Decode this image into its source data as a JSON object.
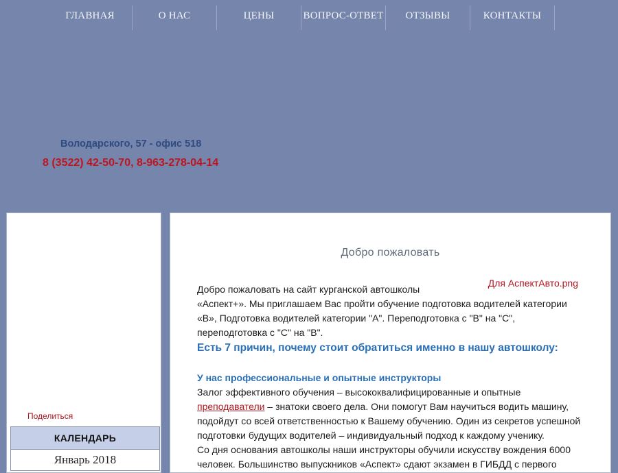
{
  "nav": {
    "items": [
      {
        "label": "ГЛАВНАЯ"
      },
      {
        "label": "О НАС"
      },
      {
        "label": "ЦЕНЫ"
      },
      {
        "label": "ВОПРОС-ОТВЕТ"
      },
      {
        "label": "ОТЗЫВЫ"
      },
      {
        "label": "КОНТАКТЫ"
      }
    ]
  },
  "header": {
    "address": "Володарского, 57 - офис 518",
    "phone": "8 (3522) 42-50-70, 8-963-278-04-14"
  },
  "sidebar": {
    "share_label": "Поделиться",
    "calendar_title": "КАЛЕНДАРЬ",
    "calendar_month": "Январь 2018"
  },
  "main": {
    "title": "Добро пожаловать",
    "image_alt": "Для АспектАвто.png",
    "intro_line1": "Добро пожаловать на сайт курганской автошколы",
    "intro_line2": "«Аспект+». Мы приглашаем Вас пройти обучение подготовка водителей категории «В», Подготовка водителей категории \"А\". Переподготовка с \"В\" на \"С\", переподготовка с \"С\" на \"В\".",
    "reasons_heading": "Есть 7 причин, почему стоит обратиться именно в нашу автошколу:",
    "reason1_heading": "У нас профессиональные и опытные инструкторы",
    "reason1_text_before": "Залог эффективного обучения – высококвалифицированные и опытные ",
    "reason1_link": "преподаватели",
    "reason1_text_after": " – знатоки своего дела. Они помогут Вам научиться водить машину, подойдут со всей ответственностью к Вашему обучению. Один из секретов успешной подготовки будущих водителей – индивидуальный подход к каждому ученику.",
    "reason1_text2": "Со дня основания автошколы наши инструкторы обучили искусству вождения 6000 человек. Большинство выпускников «Аспект» сдают экзамен в ГИБДД с первого"
  },
  "colors": {
    "page_bg": "#7585ab",
    "accent_blue": "#2a6fb5",
    "accent_red": "#b0161f"
  }
}
